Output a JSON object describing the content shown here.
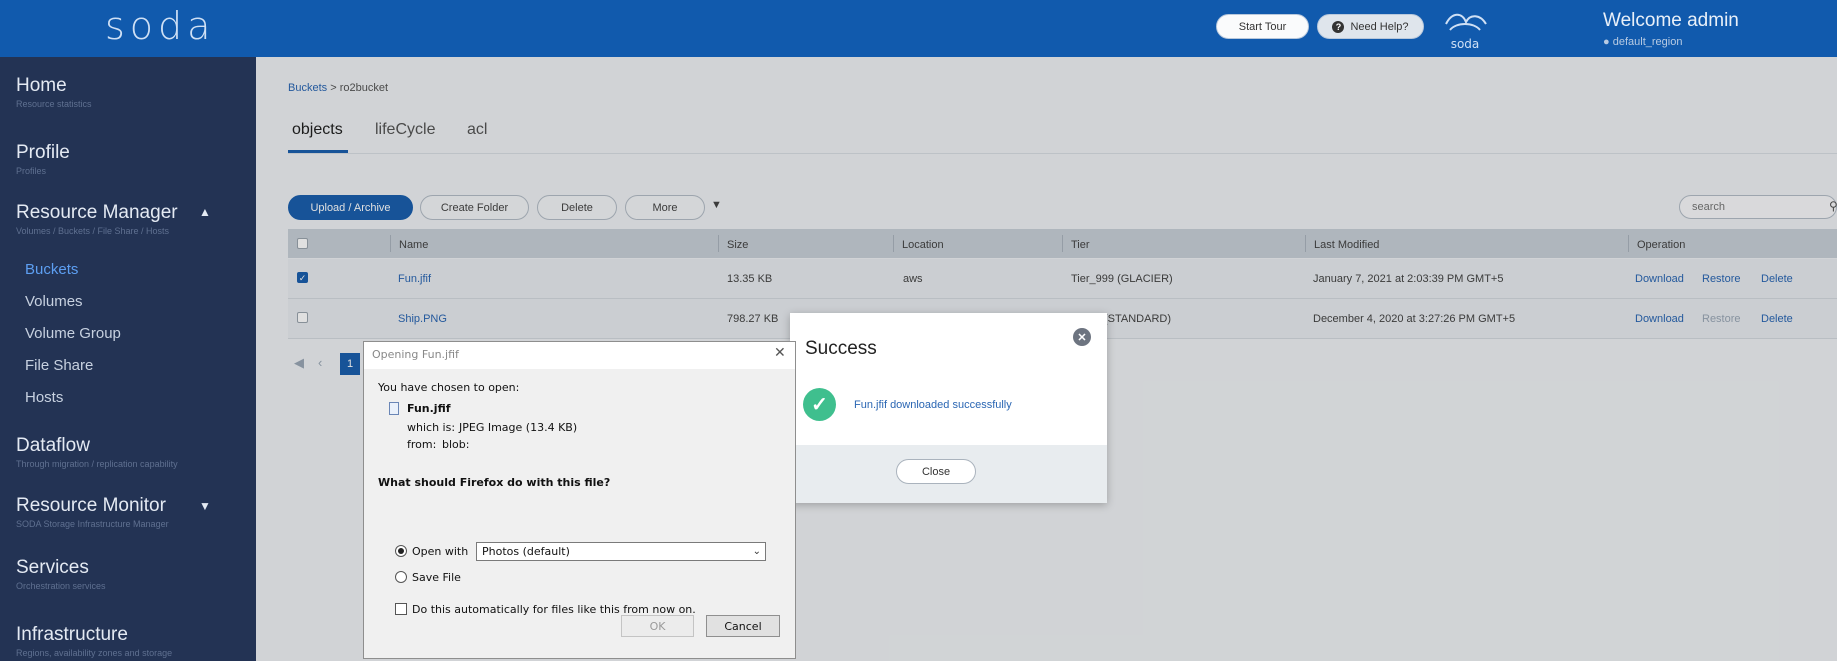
{
  "header": {
    "logo": "soda",
    "start_tour": "Start Tour",
    "need_help": "Need Help?",
    "brand_small": "SODA",
    "welcome": "Welcome admin",
    "region": "default_region"
  },
  "sidebar": {
    "home": {
      "title": "Home",
      "sub": "Resource statistics"
    },
    "profile": {
      "title": "Profile",
      "sub": "Profiles"
    },
    "resource_manager": {
      "title": "Resource Manager",
      "sub": "Volumes / Buckets / File Share / Hosts"
    },
    "children": [
      "Buckets",
      "Volumes",
      "Volume Group",
      "File Share",
      "Hosts"
    ],
    "dataflow": {
      "title": "Dataflow",
      "sub": "Through migration / replication capability"
    },
    "resource_monitor": {
      "title": "Resource Monitor",
      "sub": "SODA Storage Infrastructure Manager"
    },
    "services": {
      "title": "Services",
      "sub": "Orchestration services"
    },
    "infrastructure": {
      "title": "Infrastructure",
      "sub": "Regions, availability zones and storage"
    }
  },
  "breadcrumb": {
    "link": "Buckets",
    "sep": " > ",
    "current": "ro2bucket"
  },
  "tabs": [
    "objects",
    "lifeCycle",
    "acl"
  ],
  "toolbar": {
    "upload": "Upload / Archive",
    "create_folder": "Create Folder",
    "delete": "Delete",
    "more": "More",
    "search_placeholder": "search"
  },
  "table": {
    "headers": [
      "Name",
      "Size",
      "Location",
      "Tier",
      "Last Modified",
      "Operation"
    ],
    "rows": [
      {
        "name": "Fun.jfif",
        "size": "13.35 KB",
        "location": "aws",
        "tier": "Tier_999 (GLACIER)",
        "modified": "January 7, 2021 at 2:03:39 PM GMT+5",
        "ops": [
          "Download",
          "Restore",
          "Delete"
        ]
      },
      {
        "name": "Ship.PNG",
        "size": "798.27 KB",
        "location": "",
        "tier": "(STANDARD)",
        "modified": "December 4, 2020 at 3:27:26 PM GMT+5",
        "ops": [
          "Download",
          "Restore",
          "Delete"
        ]
      }
    ],
    "page": "1"
  },
  "success_dialog": {
    "title": "Success",
    "message": "Fun.jfif downloaded successfully",
    "close": "Close"
  },
  "firefox_dialog": {
    "title": "Opening Fun.jfif",
    "chosen": "You have chosen to open:",
    "filename": "Fun.jfif",
    "which_is_label": "which is:",
    "which_is_value": "JPEG Image (13.4 KB)",
    "from_label": "from:",
    "from_value": "blob:",
    "question": "What should Firefox do with this file?",
    "open_with": "Open with",
    "app": "Photos (default)",
    "save_file": "Save File",
    "auto": "Do this automatically for files like this from now on.",
    "ok": "OK",
    "cancel": "Cancel"
  },
  "colors": {
    "header": "#115aad",
    "sidebar": "#233354",
    "accent": "#1b5fad",
    "success": "#3fbf8e"
  }
}
